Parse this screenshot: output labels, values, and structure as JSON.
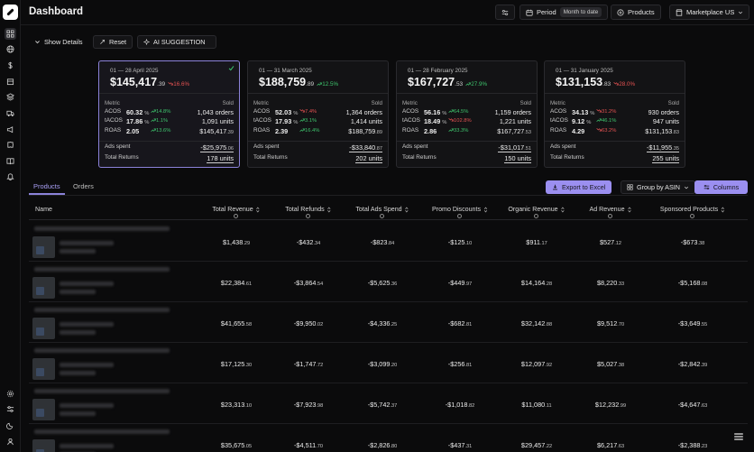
{
  "header": {
    "title": "Dashboard",
    "period_label": "Period",
    "period_value": "Month to date",
    "products_label": "Products",
    "marketplace_label": "Marketplace US"
  },
  "toolbar": {
    "show_details": "Show Details",
    "reset": "Reset",
    "ai_suggestion": "AI SUGGESTION"
  },
  "cards": [
    {
      "date": "01 — 28 April 2025",
      "total": "$145,417",
      "total_cents": ".39",
      "change": "16.6%",
      "change_dir": "down",
      "metric_head": "Metric",
      "sold_head": "Sold",
      "metrics": [
        {
          "label": "ACOS",
          "value": "60.32",
          "pct": "%",
          "change": "14.8%",
          "dir": "up",
          "sold": "1,043 orders",
          "sold_cents": ""
        },
        {
          "label": "tACOS",
          "value": "17.86",
          "pct": "%",
          "change": "1.1%",
          "dir": "up",
          "sold": "1,091 units",
          "sold_cents": ""
        },
        {
          "label": "ROAS",
          "value": "2.05",
          "pct": "",
          "change": "13.6%",
          "dir": "up",
          "sold": "$145,417",
          "sold_cents": ".39"
        }
      ],
      "ads_label": "Ads spent",
      "ads_value": "-$25,975",
      "ads_cents": ".06",
      "returns_label": "Total Returns",
      "returns_value": "178 units",
      "selected": true
    },
    {
      "date": "01 — 31 March 2025",
      "total": "$188,759",
      "total_cents": ".89",
      "change": "12.5%",
      "change_dir": "up",
      "metric_head": "Metric",
      "sold_head": "Sold",
      "metrics": [
        {
          "label": "ACOS",
          "value": "52.03",
          "pct": "%",
          "change": "7.4%",
          "dir": "down",
          "sold": "1,364 orders",
          "sold_cents": ""
        },
        {
          "label": "tACOS",
          "value": "17.93",
          "pct": "%",
          "change": "3.1%",
          "dir": "up",
          "sold": "1,414 units",
          "sold_cents": ""
        },
        {
          "label": "ROAS",
          "value": "2.39",
          "pct": "",
          "change": "16.4%",
          "dir": "up",
          "sold": "$188,759",
          "sold_cents": ".89"
        }
      ],
      "ads_label": "Ads spent",
      "ads_value": "-$33,840",
      "ads_cents": ".87",
      "returns_label": "Total Returns",
      "returns_value": "202 units",
      "selected": false
    },
    {
      "date": "01 — 28 February 2025",
      "total": "$167,727",
      "total_cents": ".53",
      "change": "27.9%",
      "change_dir": "up",
      "metric_head": "Metric",
      "sold_head": "Sold",
      "metrics": [
        {
          "label": "ACOS",
          "value": "56.16",
          "pct": "%",
          "change": "64.5%",
          "dir": "up",
          "sold": "1,159 orders",
          "sold_cents": ""
        },
        {
          "label": "tACOS",
          "value": "18.49",
          "pct": "%",
          "change": "102.8%",
          "dir": "down",
          "sold": "1,221 units",
          "sold_cents": ""
        },
        {
          "label": "ROAS",
          "value": "2.86",
          "pct": "",
          "change": "33.3%",
          "dir": "up",
          "sold": "$167,727",
          "sold_cents": ".53"
        }
      ],
      "ads_label": "Ads spent",
      "ads_value": "-$31,017",
      "ads_cents": ".51",
      "returns_label": "Total Returns",
      "returns_value": "150 units",
      "selected": false
    },
    {
      "date": "01 — 31 January 2025",
      "total": "$131,153",
      "total_cents": ".83",
      "change": "28.0%",
      "change_dir": "down",
      "metric_head": "Metric",
      "sold_head": "Sold",
      "metrics": [
        {
          "label": "ACOS",
          "value": "34.13",
          "pct": "%",
          "change": "31.2%",
          "dir": "down",
          "sold": "930 orders",
          "sold_cents": ""
        },
        {
          "label": "tACOS",
          "value": "9.12",
          "pct": "%",
          "change": "46.1%",
          "dir": "up",
          "sold": "947 units",
          "sold_cents": ""
        },
        {
          "label": "ROAS",
          "value": "4.29",
          "pct": "",
          "change": "63.2%",
          "dir": "down",
          "sold": "$131,153",
          "sold_cents": ".83"
        }
      ],
      "ads_label": "Ads spent",
      "ads_value": "-$11,955",
      "ads_cents": ".35",
      "returns_label": "Total Returns",
      "returns_value": "255 units",
      "selected": false
    }
  ],
  "tabs": {
    "products": "Products",
    "orders": "Orders"
  },
  "actions": {
    "export": "Export to Excel",
    "group": "Group by ASIN",
    "columns": "Columns"
  },
  "table": {
    "columns": [
      "Name",
      "Total Revenue",
      "Total Refunds",
      "Total Ads Spend",
      "Promo Discounts",
      "Organic Revenue",
      "Ad Revenue",
      "Sponsored Products"
    ],
    "rows": [
      [
        [
          "$1,438",
          ".29"
        ],
        [
          "-$432",
          ".34"
        ],
        [
          "-$823",
          ".84"
        ],
        [
          "-$125",
          ".10"
        ],
        [
          "$911",
          ".17"
        ],
        [
          "$527",
          ".12"
        ],
        [
          "-$673",
          ".38"
        ]
      ],
      [
        [
          "$22,384",
          ".61"
        ],
        [
          "-$3,864",
          ".54"
        ],
        [
          "-$5,625",
          ".36"
        ],
        [
          "-$449",
          ".97"
        ],
        [
          "$14,164",
          ".28"
        ],
        [
          "$8,220",
          ".33"
        ],
        [
          "-$5,168",
          ".08"
        ]
      ],
      [
        [
          "$41,655",
          ".58"
        ],
        [
          "-$9,950",
          ".02"
        ],
        [
          "-$4,336",
          ".25"
        ],
        [
          "-$682",
          ".81"
        ],
        [
          "$32,142",
          ".88"
        ],
        [
          "$9,512",
          ".70"
        ],
        [
          "-$3,649",
          ".55"
        ]
      ],
      [
        [
          "$17,125",
          ".30"
        ],
        [
          "-$1,747",
          ".72"
        ],
        [
          "-$3,099",
          ".20"
        ],
        [
          "-$256",
          ".81"
        ],
        [
          "$12,097",
          ".92"
        ],
        [
          "$5,027",
          ".38"
        ],
        [
          "-$2,842",
          ".39"
        ]
      ],
      [
        [
          "$23,313",
          ".10"
        ],
        [
          "-$7,923",
          ".98"
        ],
        [
          "-$5,742",
          ".37"
        ],
        [
          "-$1,018",
          ".82"
        ],
        [
          "$11,080",
          ".11"
        ],
        [
          "$12,232",
          ".99"
        ],
        [
          "-$4,647",
          ".63"
        ]
      ],
      [
        [
          "$35,675",
          ".05"
        ],
        [
          "-$4,511",
          ".70"
        ],
        [
          "-$2,826",
          ".80"
        ],
        [
          "-$437",
          ".31"
        ],
        [
          "$29,457",
          ".22"
        ],
        [
          "$6,217",
          ".63"
        ],
        [
          "-$2,388",
          ".23"
        ]
      ]
    ]
  },
  "colors": {
    "accent": "#9b8ff0",
    "up": "#3ec46d",
    "down": "#e45252",
    "background": "#0b0b0c"
  },
  "icons": {
    "sidebar_top": [
      "grid-icon",
      "globe-icon",
      "dollar-icon",
      "box-icon",
      "layers-icon",
      "truck-icon",
      "megaphone-icon",
      "puzzle-icon",
      "book-icon",
      "bell-icon"
    ],
    "sidebar_bottom": [
      "settings-icon",
      "sliders-icon",
      "moon-icon",
      "user-icon"
    ]
  }
}
